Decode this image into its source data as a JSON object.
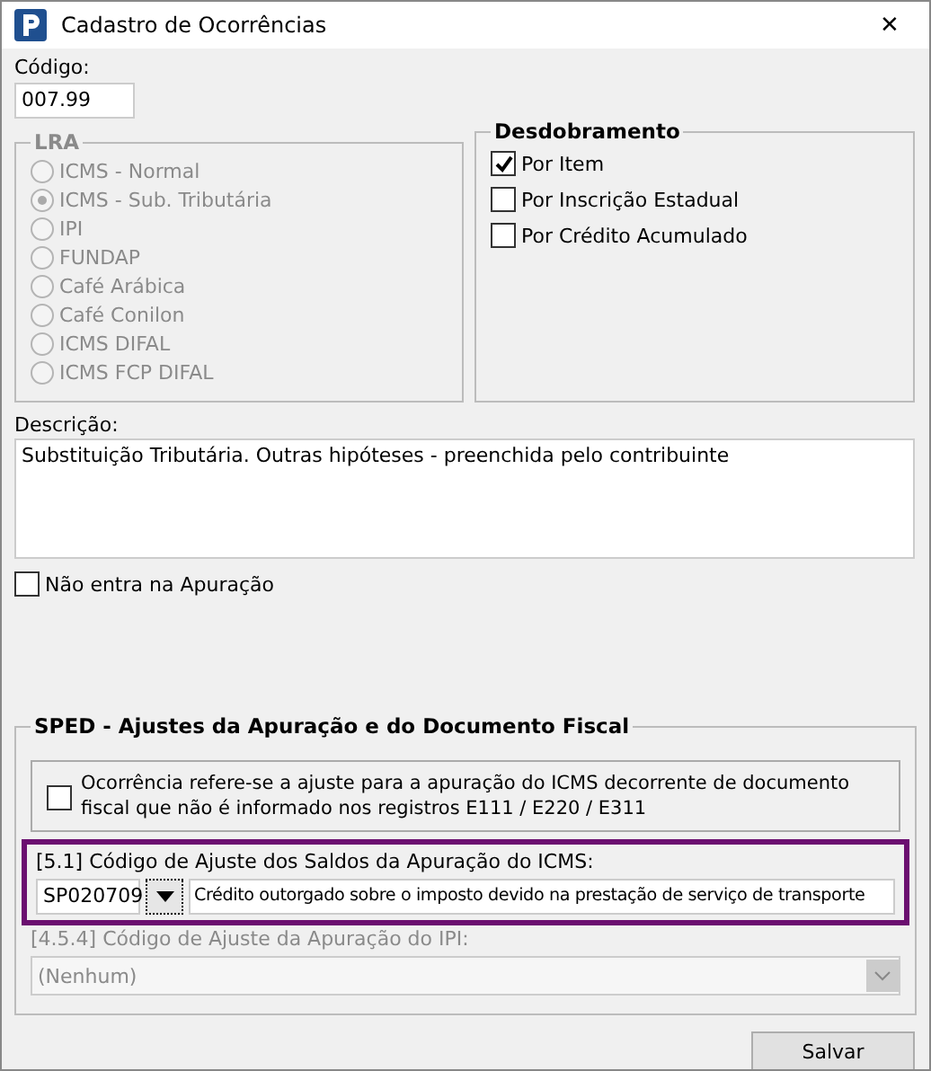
{
  "window": {
    "title": "Cadastro de Ocorrências",
    "close": "✕"
  },
  "codigo": {
    "label": "Código:",
    "value": "007.99"
  },
  "lra": {
    "title": "LRA",
    "disabled": true,
    "options": [
      {
        "label": "ICMS - Normal",
        "selected": false
      },
      {
        "label": "ICMS - Sub. Tributária",
        "selected": true
      },
      {
        "label": "IPI",
        "selected": false
      },
      {
        "label": "FUNDAP",
        "selected": false
      },
      {
        "label": "Café Arábica",
        "selected": false
      },
      {
        "label": "Café Conilon",
        "selected": false
      },
      {
        "label": "ICMS DIFAL",
        "selected": false
      },
      {
        "label": "ICMS FCP DIFAL",
        "selected": false
      }
    ]
  },
  "desdobramento": {
    "title": "Desdobramento",
    "options": [
      {
        "label": "Por Item",
        "checked": true
      },
      {
        "label": "Por Inscrição Estadual",
        "checked": false
      },
      {
        "label": "Por Crédito Acumulado",
        "checked": false
      }
    ]
  },
  "descricao": {
    "label": "Descrição:",
    "value": "Substituição Tributária. Outras hipóteses - preenchida pelo contribuinte"
  },
  "nao_entra": {
    "label": "Não entra na Apuração",
    "checked": false
  },
  "sped": {
    "title": "SPED - Ajustes da Apuração e do Documento Fiscal",
    "ocorrencia": {
      "label": "Ocorrência refere-se a ajuste para a apuração do ICMS decorrente de documento fiscal que não é informado nos registros E111 / E220 / E311",
      "checked": false
    },
    "icms": {
      "label": "[5.1] Código de Ajuste dos Saldos da Apuração do ICMS:",
      "code": "SP020709",
      "description": "Crédito outorgado sobre o imposto devido na prestação de serviço de transporte",
      "highlighted": true
    },
    "ipi": {
      "label": "[4.5.4] Código de Ajuste da Apuração do IPI:",
      "value": "(Nenhum)",
      "disabled": true
    }
  },
  "buttons": [
    {
      "label": "Salvar"
    }
  ]
}
